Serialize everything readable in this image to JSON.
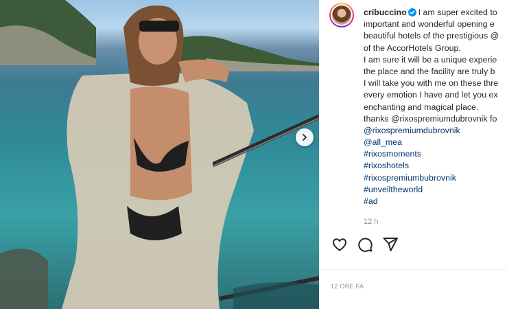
{
  "post": {
    "username": "cribuccino",
    "caption_lines": [
      "I am super excited to",
      "important and wonderful opening e",
      "beautiful hotels of the prestigious @",
      "of the AccorHotels Group.",
      "I am sure it will be a unique experie",
      "the place and the facility are truly b",
      "I will take you with me on these thre",
      "every emotion I have and let you ex",
      "enchanting and magical place.",
      "thanks @rixospremiumdubrovnik fo"
    ],
    "tags": [
      "@rixospremiumdubrovnik",
      "@all_mea",
      "#rixosmoments",
      "#rixoshotels",
      "#rixospremiumbubrovnik",
      "#unveiltheworld",
      "#ad"
    ],
    "timestamp": "12 h",
    "footer_time": "12 ORE FA"
  },
  "icons": {
    "verified": "verified-badge-icon",
    "next": "chevron-right-icon",
    "like": "heart-icon",
    "comment": "comment-icon",
    "share": "paper-plane-icon"
  },
  "colors": {
    "text": "#262626",
    "link": "#00376b",
    "secondary": "#8e8e8e",
    "verified": "#0095f6"
  }
}
